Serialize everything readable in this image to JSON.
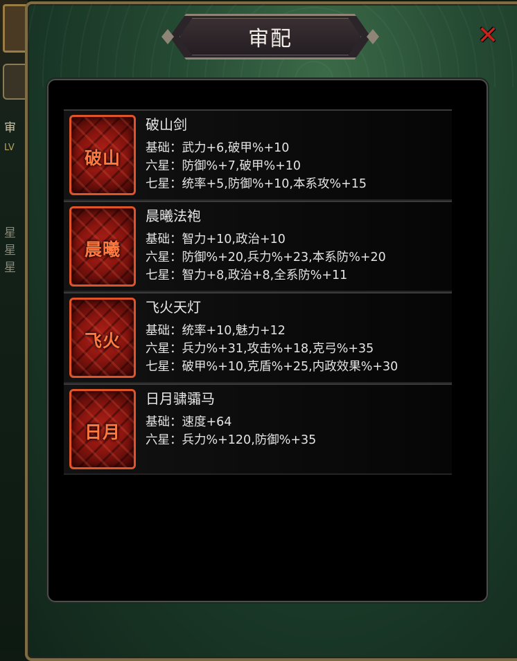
{
  "background": {
    "left_fragments": [
      "审",
      "LV",
      "星",
      "星",
      "星"
    ]
  },
  "dialog": {
    "title": "审配",
    "close_icon": "close-x-icon"
  },
  "items": [
    {
      "name": "破山剑",
      "icon_text": "破山",
      "stats": [
        {
          "label": "基础：",
          "value": "武力+6,破甲%+10"
        },
        {
          "label": "六星：",
          "value": "防御%+7,破甲%+10"
        },
        {
          "label": "七星：",
          "value": "统率+5,防御%+10,本系攻%+15"
        }
      ]
    },
    {
      "name": "晨曦法袍",
      "icon_text": "晨曦",
      "stats": [
        {
          "label": "基础：",
          "value": "智力+10,政治+10"
        },
        {
          "label": "六星：",
          "value": "防御%+20,兵力%+23,本系防%+20"
        },
        {
          "label": "七星：",
          "value": "智力+8,政治+8,全系防%+11"
        }
      ]
    },
    {
      "name": "飞火天灯",
      "icon_text": "飞火",
      "stats": [
        {
          "label": "基础：",
          "value": "统率+10,魅力+12"
        },
        {
          "label": "六星：",
          "value": "兵力%+31,攻击%+18,克弓%+35"
        },
        {
          "label": "七星：",
          "value": "破甲%+10,克盾%+25,内政效果%+30"
        }
      ]
    },
    {
      "name": "日月骕骦马",
      "icon_text": "日月",
      "stats": [
        {
          "label": "基础：",
          "value": "速度+64"
        },
        {
          "label": "六星：",
          "value": "兵力%+120,防御%+35"
        }
      ]
    }
  ],
  "colors": {
    "icon_border": "#e0542a",
    "icon_fill": "#b3231a",
    "close": "#c8231e",
    "panel_green": "#254a33"
  }
}
